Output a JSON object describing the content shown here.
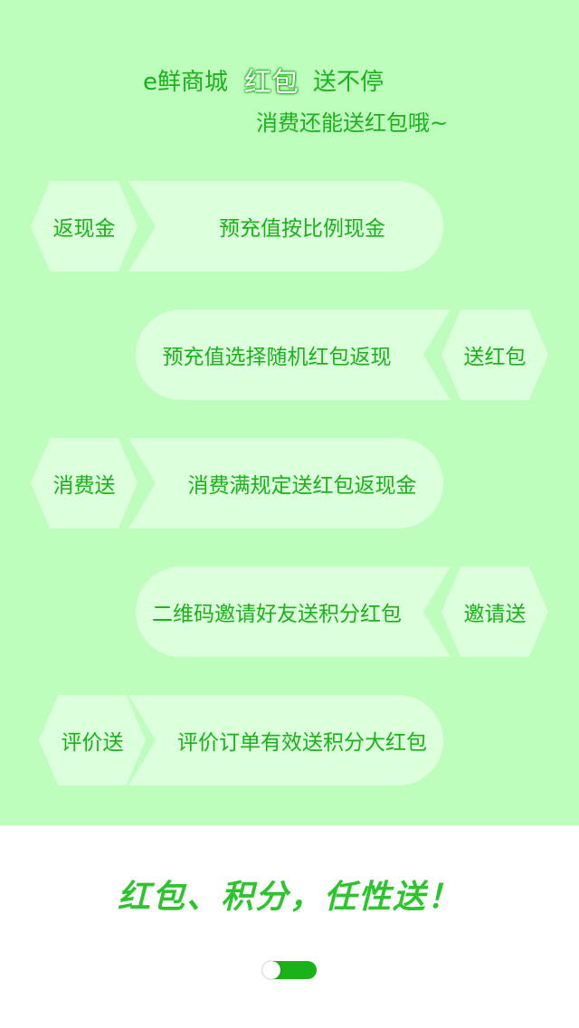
{
  "header": {
    "brand": "e鲜商城",
    "highlight": "红包",
    "tagline": "送不停",
    "subtitle": "消费还能送红包哦~"
  },
  "rows": [
    {
      "badge": "返现金",
      "text": "预充值按比例现金"
    },
    {
      "badge": "送红包",
      "text": "预充值选择随机红包返现"
    },
    {
      "badge": "消费送",
      "text": "消费满规定送红包返现金"
    },
    {
      "badge": "邀请送",
      "text": "二维码邀请好友送积分红包"
    },
    {
      "badge": "评价送",
      "text": "评价订单有效送积分大红包"
    }
  ],
  "slogan": "红包、积分，任性送！",
  "colors": {
    "background_top": "#bdfebd",
    "card": "#dcffdc",
    "text_green": "#19b219",
    "slogan_green": "#2ec42e",
    "toggle_on": "#19b219"
  }
}
